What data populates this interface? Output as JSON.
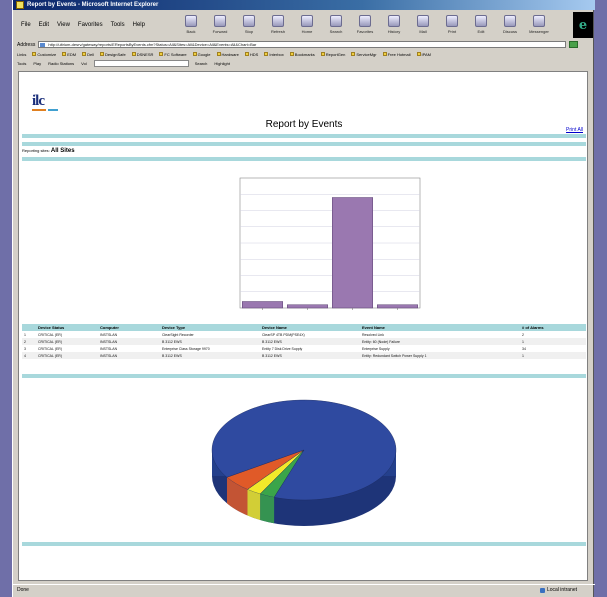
{
  "window": {
    "title": "Report by Events - Microsoft Internet Explorer"
  },
  "menu": [
    "File",
    "Edit",
    "View",
    "Favorites",
    "Tools",
    "Help"
  ],
  "toolbar": [
    {
      "label": "Back",
      "icon": "back-icon"
    },
    {
      "label": "Forward",
      "icon": "forward-icon"
    },
    {
      "label": "Stop",
      "icon": "stop-icon"
    },
    {
      "label": "Refresh",
      "icon": "refresh-icon"
    },
    {
      "label": "Home",
      "icon": "home-icon"
    },
    {
      "label": "Search",
      "icon": "search-icon"
    },
    {
      "label": "Favorites",
      "icon": "favorites-icon"
    },
    {
      "label": "History",
      "icon": "history-icon"
    },
    {
      "label": "Mail",
      "icon": "mail-icon"
    },
    {
      "label": "Print",
      "icon": "print-icon"
    },
    {
      "label": "Edit",
      "icon": "edit-icon"
    },
    {
      "label": "Discuss",
      "icon": "discuss-icon"
    },
    {
      "label": "Messenger",
      "icon": "messenger-icon"
    }
  ],
  "address": {
    "label": "Address",
    "value": "http://ultrium-desrv/gateway/reports/EReportsByEvents.cfm?Status=All&Sites=All&Device=All&Events=All&Chart=Bar"
  },
  "links": [
    "Links",
    "Customize",
    "EDM",
    "Dell",
    "DesignSafe",
    "DSNESR",
    "FC Software",
    "Google",
    "Hardware",
    "HDS",
    "Interbox",
    "Bookmarks",
    "ReportGen",
    "ServiceMgr",
    "Free Hotmail",
    "IPAM"
  ],
  "tools": [
    "Tools",
    "Play",
    "Radio Stations",
    "Vol",
    "Search",
    "Highlight"
  ],
  "report": {
    "title": "Report by Events",
    "print": "Print All",
    "reporting_label": "Reporting sites:",
    "reporting_value": "All Sites"
  },
  "table": {
    "headers": [
      "",
      "Device Status",
      "Computer",
      "Device Type",
      "Device Name",
      "Event Name",
      "# of Alarms"
    ],
    "rows": [
      [
        "1",
        "CRITICAL (ER)",
        "INSTSLAN",
        "ClearSight Recorder",
        "ClearSP 4TB PDM(PSE4X)",
        "Resolved Link",
        "2"
      ],
      [
        "2",
        "CRITICAL (ER)",
        "INSTSLAN",
        "B 3112 EWS",
        "B 3112 EWS",
        "Entity: 60 (Node) Failure",
        "1"
      ],
      [
        "3",
        "CRITICAL (ER)",
        "INSTSLAN",
        "Enterprise Class Storage 9970",
        "Entity 7 Disk Drive Supply",
        "Enterprise Supply",
        "34"
      ],
      [
        "4",
        "CRITICAL (ER)",
        "INSTSLAN",
        "B 3112 EWS",
        "B 3112 EWS",
        "Entity: Redundant Switch Power Supply 1",
        "1"
      ]
    ]
  },
  "chart_data": [
    {
      "type": "bar",
      "categories": [
        "1",
        "2",
        "3",
        "4"
      ],
      "values": [
        2,
        1,
        34,
        1
      ],
      "ylim": [
        0,
        40
      ],
      "grid": true,
      "color": "#9a78b0"
    },
    {
      "type": "pie",
      "values": [
        34,
        2,
        1,
        1
      ],
      "colors": [
        "#2f4aa0",
        "#e05a28",
        "#f2ea2a",
        "#3aa54a"
      ]
    }
  ],
  "status": {
    "left": "Done",
    "zone": "Local intranet"
  }
}
